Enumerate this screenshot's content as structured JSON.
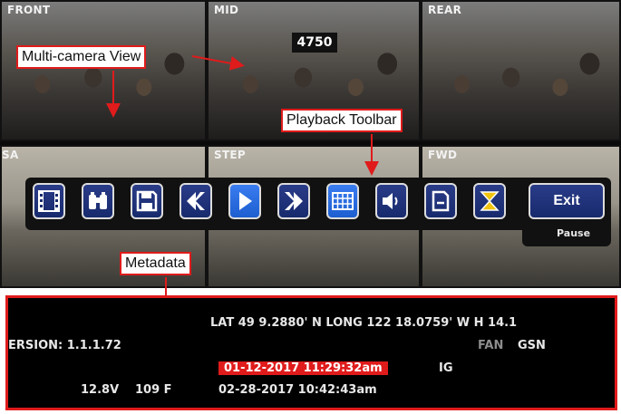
{
  "cameras": {
    "front": "FRONT",
    "mid": "MID",
    "rear": "REAR",
    "sa": "SA",
    "step": "STEP",
    "fwd": "FWD",
    "mid_counter": "4750"
  },
  "callouts": {
    "multi_camera": "Multi-camera View",
    "playback_toolbar": "Playback Toolbar",
    "metadata": "Metadata"
  },
  "toolbar": {
    "buttons": [
      {
        "icon": "film-clip-icon"
      },
      {
        "icon": "binoculars-icon"
      },
      {
        "icon": "save-icon"
      },
      {
        "icon": "rewind-icon"
      },
      {
        "icon": "play-icon"
      },
      {
        "icon": "fast-forward-icon"
      },
      {
        "icon": "grid-icon"
      },
      {
        "icon": "speaker-icon"
      },
      {
        "icon": "document-icon"
      },
      {
        "icon": "hourglass-icon"
      }
    ],
    "exit_label": "Exit",
    "status": "Pause"
  },
  "metadata": {
    "gps": "LAT 49   9.2880' N  LONG  122  18.0759' W  H  14.1",
    "version": "ERSION:  1.1.1.72",
    "fan": "FAN",
    "gsn": "GSN",
    "timestamp_current": "01-12-2017  11:29:32am",
    "ig": "IG",
    "voltage": "12.8V",
    "temperature": "109  F",
    "timestamp_other": "02-28-2017  10:42:43am"
  },
  "colors": {
    "accent_red": "#e01b1b",
    "button_blue": "#1d2f74",
    "active_blue": "#2f73e8"
  }
}
